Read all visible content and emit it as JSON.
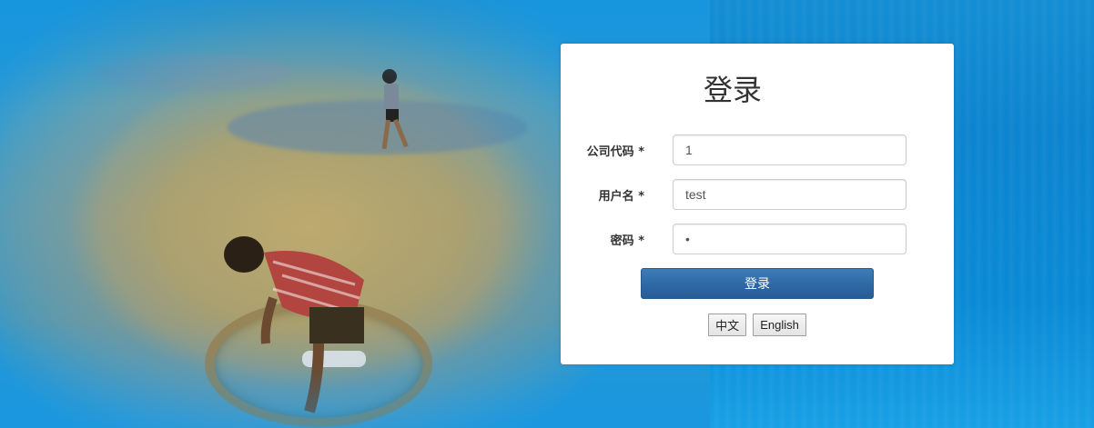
{
  "login": {
    "title": "登录",
    "fields": [
      {
        "label": "公司代码 *",
        "value": "1",
        "type": "text"
      },
      {
        "label": "用户名 *",
        "value": "test",
        "type": "text"
      },
      {
        "label": "密码 *",
        "value": "•",
        "type": "password"
      }
    ],
    "submit_label": "登录",
    "languages": [
      "中文",
      "English"
    ]
  },
  "colors": {
    "background_blue": "#0e86d0",
    "button_blue": "#2f6aa5",
    "card_white": "#ffffff"
  }
}
